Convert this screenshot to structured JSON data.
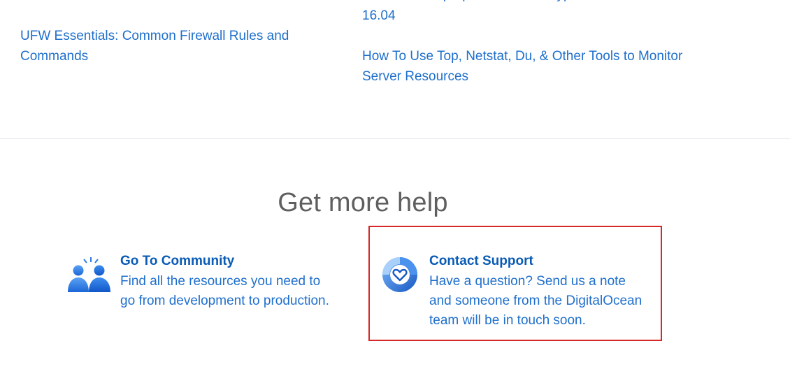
{
  "related_articles": {
    "partial_left_top": "... y",
    "partial_right_top": "16.04",
    "left_link": {
      "line1": "UFW Essentials: Common Firewall Rules and",
      "line2": "Commands"
    },
    "right_link": {
      "line1": "How To Use Top, Netstat, Du, & Other Tools to Monitor",
      "line2": "Server Resources"
    }
  },
  "help": {
    "title": "Get more help",
    "community": {
      "title": "Go To Community",
      "desc_line1": "Find all the resources you need to",
      "desc_line2": "go from development to production.",
      "icon": "community-icon"
    },
    "support": {
      "title": "Contact Support",
      "desc_line1": "Have a question? Send us a note",
      "desc_line2": "and someone from the DigitalOcean",
      "desc_line3": "team will be in touch soon.",
      "icon": "support-heart-icon"
    }
  },
  "colors": {
    "link": "#1f6fcc",
    "card_title": "#0a5bb5",
    "heading": "#5f5f5f",
    "highlight_border": "#d62828"
  }
}
